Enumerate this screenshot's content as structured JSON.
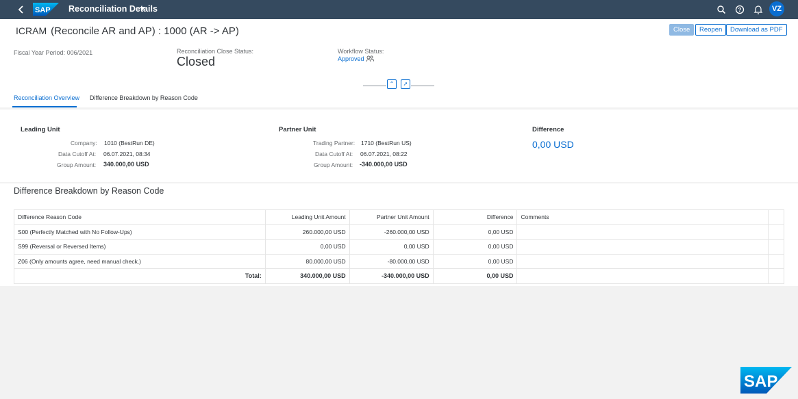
{
  "shell": {
    "title": "Reconciliation Details",
    "avatar_initials": "VZ"
  },
  "header": {
    "object_code": "ICRAM",
    "object_title": "(Reconcile AR and AP) : 1000 (AR -> AP)",
    "buttons": {
      "close": "Close",
      "reopen": "Reopen",
      "download": "Download as PDF"
    },
    "fiscal_year_label": "Fiscal Year Period:",
    "fiscal_year_value": "006/2021",
    "close_status_label": "Reconciliation Close Status:",
    "close_status_value": "Closed",
    "workflow_status_label": "Workflow Status:",
    "workflow_status_value": "Approved"
  },
  "tabs": [
    {
      "label": "Reconciliation Overview",
      "active": true
    },
    {
      "label": "Difference Breakdown by Reason Code",
      "active": false
    }
  ],
  "overview": {
    "leading": {
      "title": "Leading Unit",
      "company_label": "Company:",
      "company_value": "1010 (BestRun DE)",
      "cutoff_label": "Data Cutoff At:",
      "cutoff_value": "06.07.2021, 08:34",
      "amount_label": "Group Amount:",
      "amount_value": "340.000,00",
      "amount_currency": "USD"
    },
    "partner": {
      "title": "Partner Unit",
      "partner_label": "Trading Partner:",
      "partner_value": "1710 (BestRun US)",
      "cutoff_label": "Data Cutoff At:",
      "cutoff_value": "06.07.2021, 08:22",
      "amount_label": "Group Amount:",
      "amount_value": "-340.000,00",
      "amount_currency": "USD"
    },
    "difference": {
      "title": "Difference",
      "value": "0,00 USD"
    }
  },
  "breakdown": {
    "title": "Difference Breakdown by Reason Code",
    "columns": [
      "Difference Reason Code",
      "Leading Unit Amount",
      "Partner Unit Amount",
      "Difference",
      "Comments"
    ],
    "rows": [
      {
        "reason": "S00 (Perfectly Matched with No Follow-Ups)",
        "leading": "260.000,00 USD",
        "partner": "-260.000,00 USD",
        "difference": "0,00 USD",
        "comments": ""
      },
      {
        "reason": "S99 (Reversal or Reversed Items)",
        "leading": "0,00 USD",
        "partner": "0,00 USD",
        "difference": "0,00 USD",
        "comments": ""
      },
      {
        "reason": "Z06 (Only amounts agree, need manual check.)",
        "leading": "80.000,00 USD",
        "partner": "-80.000,00 USD",
        "difference": "0,00 USD",
        "comments": ""
      }
    ],
    "total": {
      "label": "Total:",
      "leading": "340.000,00 USD",
      "partner": "-340.000,00 USD",
      "difference": "0,00 USD"
    }
  },
  "colors": {
    "shell": "#354a5f",
    "accent": "#0a6ed1",
    "background": "#f2f2f2"
  }
}
